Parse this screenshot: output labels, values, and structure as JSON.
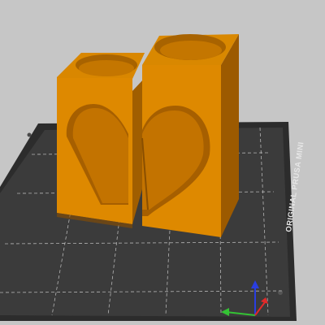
{
  "viewport": {
    "background": "#c7c7c7",
    "bed": {
      "label": "ORIGINAL PRUSA MINI",
      "surface_color": "#3b3b3b",
      "frame_color": "#2c2c2c",
      "grid_color": "#b5b5b5"
    },
    "model": {
      "name": "heart-shaped split vase",
      "color": "#e08a00"
    },
    "axes": {
      "x_color": "#e32929",
      "y_color": "#34c234",
      "z_color": "#2a3ee0"
    }
  }
}
